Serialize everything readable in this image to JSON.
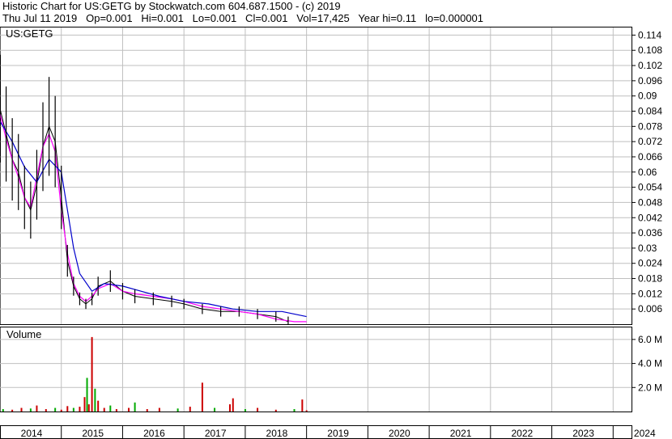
{
  "header": {
    "line1": "Historic Chart for US:GETG by Stockwatch.com 604.687.1500 - (c) 2019",
    "line2": "Thu Jul 11 2019   Op=0.001   Hi=0.001   Lo=0.001   Cl=0.001   Vol=17,425   Year hi=0.11   lo=0.000001"
  },
  "chart_data": [
    {
      "type": "candlestick-line",
      "title": "US:GETG",
      "ylim": [
        0,
        0.117
      ],
      "yticks": [
        "0.114",
        "0.108",
        "0.102",
        "0.096",
        "0.09",
        "0.084",
        "0.078",
        "0.072",
        "0.066",
        "0.06",
        "0.054",
        "0.048",
        "0.042",
        "0.036",
        "0.03",
        "0.024",
        "0.018",
        "0.012",
        "0.006"
      ],
      "ytick_values": [
        0.114,
        0.108,
        0.102,
        0.096,
        0.09,
        0.084,
        0.078,
        0.072,
        0.066,
        0.06,
        0.054,
        0.048,
        0.042,
        0.036,
        0.03,
        0.024,
        0.018,
        0.012,
        0.006
      ],
      "xlim": [
        2014.0,
        2024.3
      ],
      "grid": true,
      "series": [
        {
          "color": "#000000",
          "x": [
            2014.0,
            2014.1,
            2014.2,
            2014.3,
            2014.4,
            2014.5,
            2014.6,
            2014.7,
            2014.8,
            2014.9,
            2015.0,
            2015.1,
            2015.2,
            2015.3,
            2015.4,
            2015.5,
            2015.6,
            2015.8,
            2016.0,
            2016.2,
            2016.5,
            2016.8,
            2017.0,
            2017.3,
            2017.6,
            2017.9,
            2018.2,
            2018.5,
            2018.7
          ],
          "y": [
            0.085,
            0.075,
            0.065,
            0.06,
            0.05,
            0.045,
            0.055,
            0.07,
            0.078,
            0.072,
            0.05,
            0.025,
            0.015,
            0.01,
            0.008,
            0.01,
            0.015,
            0.017,
            0.013,
            0.011,
            0.01,
            0.009,
            0.008,
            0.006,
            0.005,
            0.005,
            0.004,
            0.003,
            0.001
          ]
        },
        {
          "color": "#ff00ff",
          "x": [
            2014.0,
            2014.1,
            2014.2,
            2014.3,
            2014.4,
            2014.5,
            2014.6,
            2014.7,
            2014.8,
            2014.9,
            2015.0,
            2015.1,
            2015.2,
            2015.3,
            2015.4,
            2015.5,
            2015.6,
            2015.8,
            2016.0,
            2016.2,
            2016.5,
            2016.8,
            2017.0,
            2017.3,
            2017.6,
            2017.9,
            2018.2,
            2018.5,
            2018.8,
            2019.0
          ],
          "y": [
            0.083,
            0.073,
            0.065,
            0.058,
            0.05,
            0.046,
            0.058,
            0.07,
            0.075,
            0.068,
            0.045,
            0.028,
            0.016,
            0.011,
            0.009,
            0.011,
            0.014,
            0.016,
            0.013,
            0.012,
            0.011,
            0.01,
            0.009,
            0.007,
            0.006,
            0.005,
            0.004,
            0.002,
            0.001,
            0.001
          ]
        },
        {
          "color": "#0000cc",
          "x": [
            2014.0,
            2014.2,
            2014.4,
            2014.6,
            2014.8,
            2015.0,
            2015.1,
            2015.2,
            2015.3,
            2015.5,
            2015.7,
            2016.0,
            2016.3,
            2016.6,
            2017.0,
            2017.4,
            2017.8,
            2018.2,
            2018.6,
            2019.0
          ],
          "y": [
            0.08,
            0.072,
            0.062,
            0.056,
            0.065,
            0.06,
            0.045,
            0.03,
            0.02,
            0.013,
            0.016,
            0.015,
            0.013,
            0.011,
            0.009,
            0.008,
            0.006,
            0.005,
            0.005,
            0.003
          ]
        }
      ]
    },
    {
      "type": "bar",
      "title": "Volume",
      "ylim": [
        0,
        7000000
      ],
      "yticks": [
        "6.0 M",
        "4.0 M",
        "2.0 M"
      ],
      "ytick_values": [
        6000000,
        4000000,
        2000000
      ],
      "xlim": [
        2014.0,
        2024.3
      ],
      "x": [
        2014.05,
        2014.2,
        2014.35,
        2014.5,
        2014.6,
        2014.75,
        2014.9,
        2015.0,
        2015.1,
        2015.2,
        2015.3,
        2015.38,
        2015.42,
        2015.45,
        2015.5,
        2015.55,
        2015.6,
        2015.7,
        2015.8,
        2015.9,
        2016.1,
        2016.2,
        2016.4,
        2016.6,
        2016.9,
        2017.1,
        2017.3,
        2017.5,
        2017.75,
        2017.8,
        2018.0,
        2018.2,
        2018.5,
        2018.8,
        2018.93,
        2019.0
      ],
      "values": [
        200000,
        150000,
        300000,
        250000,
        500000,
        200000,
        300000,
        150000,
        450000,
        300000,
        400000,
        1200000,
        2800000,
        600000,
        6200000,
        1900000,
        900000,
        300000,
        500000,
        200000,
        300000,
        750000,
        200000,
        300000,
        250000,
        400000,
        2400000,
        300000,
        600000,
        1100000,
        200000,
        300000,
        150000,
        200000,
        1000000,
        100000
      ]
    }
  ],
  "xaxis": {
    "labels": [
      "2014",
      "2015",
      "2016",
      "2017",
      "2018",
      "2019",
      "2020",
      "2021",
      "2022",
      "2023",
      "2024"
    ],
    "values": [
      2014,
      2015,
      2016,
      2017,
      2018,
      2019,
      2020,
      2021,
      2022,
      2023,
      2024
    ]
  }
}
